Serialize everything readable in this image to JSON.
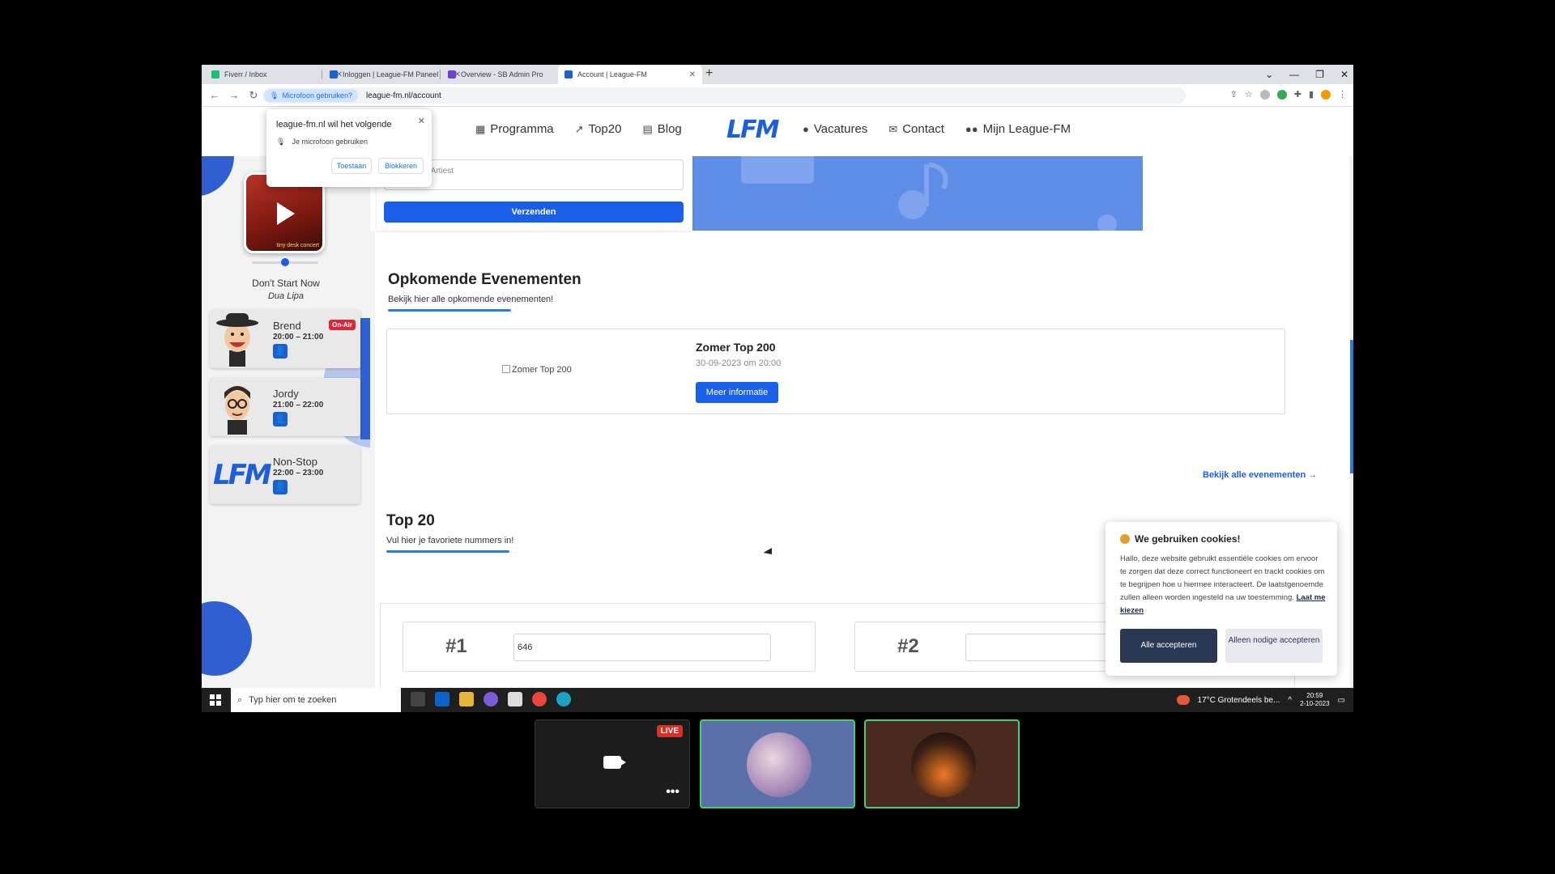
{
  "browser": {
    "tabs": [
      {
        "title": "Fiverr / Inbox",
        "favicon_color": "#1dbf73"
      },
      {
        "title": "Inloggen | League-FM Paneel",
        "favicon_color": "#1e5fd6"
      },
      {
        "title": "Overview - SB Admin Pro",
        "favicon_color": "#6c3fd8"
      },
      {
        "title": "Account | League-FM",
        "favicon_color": "#1e5fd6"
      }
    ],
    "mic_chip": "Microfoon gebruiken?",
    "url": "league-fm.nl/account"
  },
  "permission_popup": {
    "title": "league-fm.nl wil het volgende",
    "request": "Je microfoon gebruiken",
    "allow": "Toestaan",
    "block": "Blokkeren"
  },
  "site_nav": {
    "left": [
      {
        "label": "Programma",
        "icon": "calendar-icon"
      },
      {
        "label": "Top20",
        "icon": "trending-icon"
      },
      {
        "label": "Blog",
        "icon": "newspaper-icon"
      }
    ],
    "logo": "LFM",
    "right": [
      {
        "label": "Vacatures",
        "icon": "user-icon"
      },
      {
        "label": "Contact",
        "icon": "envelope-icon"
      },
      {
        "label": "Mijn League-FM",
        "icon": "users-icon"
      }
    ]
  },
  "player": {
    "thumb_caption": "tiny desk concert",
    "song": "Don't Start Now",
    "artist": "Dua Lipa"
  },
  "schedule": [
    {
      "name": "Brend",
      "time": "20:00 – 21:00",
      "badge": "On-Air"
    },
    {
      "name": "Jordy",
      "time": "21:00 – 22:00",
      "badge": ""
    },
    {
      "name": "Non-Stop",
      "time": "22:00 – 23:00",
      "badge": ""
    }
  ],
  "request_form": {
    "placeholder": "Nummer - Artiest",
    "submit": "Verzenden"
  },
  "events": {
    "title": "Opkomende Evenementen",
    "subtitle": "Bekijk hier alle opkomende evenementen!",
    "items": [
      {
        "image_alt": "Zomer Top 200",
        "name": "Zomer Top 200",
        "date": "30-09-2023 om 20:00",
        "button": "Meer informatie"
      }
    ],
    "view_all": "Bekijk alle evenementen →"
  },
  "top20": {
    "title": "Top 20",
    "subtitle": "Vul hier je favoriete nummers in!",
    "entries": [
      {
        "rank": "#1",
        "value": "646"
      },
      {
        "rank": "#2",
        "value": ""
      }
    ]
  },
  "cookie": {
    "title": "We gebruiken cookies!",
    "body": "Hallo, deze website gebruikt essentiële cookies om ervoor te zorgen dat deze correct functioneert en trackt cookies om te begrijpen hoe u hiermee interacteert. De laatstgenoemde zullen alleen worden ingesteld na uw toestemming.",
    "link": "Laat me kiezen",
    "accept_all": "Alle accepteren",
    "only_needed": "Alleen nodige accepteren"
  },
  "taskbar": {
    "search_placeholder": "Typ hier om te zoeken",
    "weather": "17°C  Grotendeels be...",
    "time": "20:59",
    "date": "2-10-2023"
  },
  "call": {
    "live_label": "LIVE"
  }
}
